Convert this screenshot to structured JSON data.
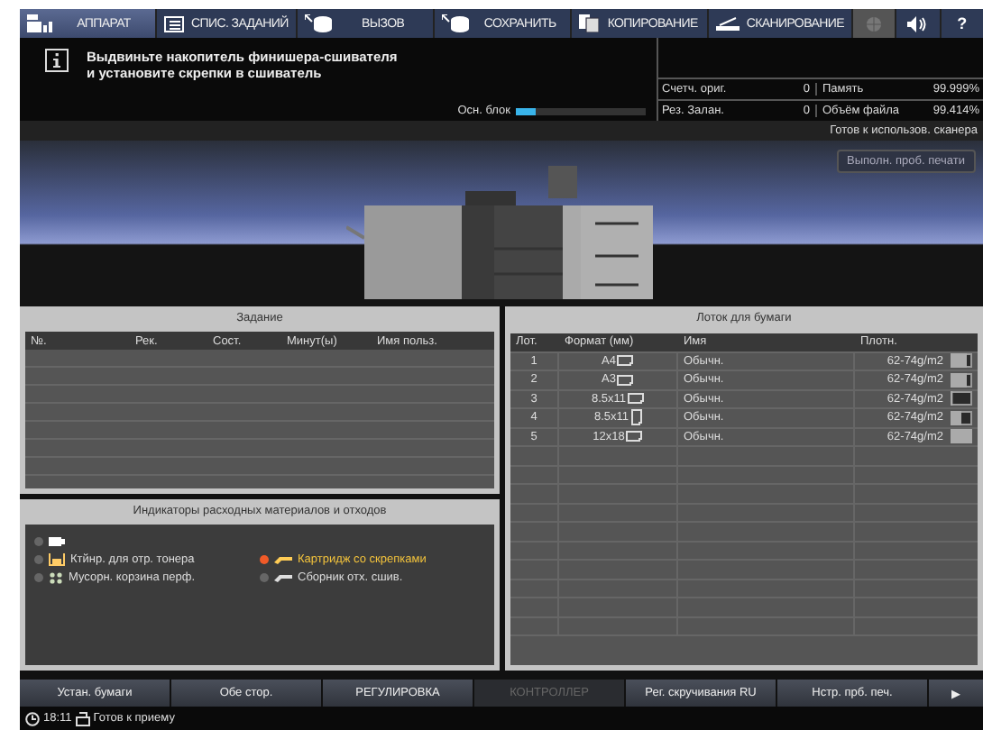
{
  "nav_tabs": [
    {
      "label": "АППАРАТ",
      "kind": "machine",
      "selected": true
    },
    {
      "label": "СПИС. ЗАДАНИЙ",
      "kind": "list",
      "selected": false
    },
    {
      "label": "ВЫЗОВ",
      "kind": "recall",
      "selected": false
    },
    {
      "label": "СОХРАНИТЬ",
      "kind": "save",
      "selected": false
    },
    {
      "label": "КОПИРОВАНИЕ",
      "kind": "copy",
      "selected": false
    },
    {
      "label": "СКАНИРОВАНИЕ",
      "kind": "scan",
      "selected": false
    }
  ],
  "nav_icons": [
    {
      "kind": "globe",
      "disabled": true
    },
    {
      "kind": "speaker",
      "disabled": false
    },
    {
      "kind": "help",
      "label": "?",
      "disabled": false
    }
  ],
  "message": {
    "lines": [
      "Выдвиньте накопитель финишера-сшивателя",
      "и установите скрепки в сшиватель"
    ],
    "progress_label": "Осн. блок",
    "level": 0.15
  },
  "counters": [
    {
      "label": "Счетч. ориг.",
      "value": "0",
      "label2": "Память",
      "value2": "99.999%"
    },
    {
      "label": "Рез. Залан.",
      "value": "0",
      "label2": "Объём файла",
      "value2": "99.414%"
    }
  ],
  "status_line": "Готов к использов. сканера",
  "test_print_button": "Выполн. проб. печати",
  "job_panel": {
    "title": "Задание",
    "columns": [
      "№.",
      "Рек.",
      "Сост.",
      "Минут(ы)",
      "Имя польз."
    ]
  },
  "consumables": {
    "title": "Индикаторы расходных материалов и отходов",
    "items": [
      {
        "kind": "cartridge",
        "alert": false
      },
      {
        "label": "Ктйнр. для отр. тонера",
        "kind": "toner",
        "alert": false
      },
      {
        "label": "Картридж со скрепками",
        "kind": "staple",
        "alert": true
      },
      {
        "label": "Мусорн. корзина перф.",
        "kind": "punch",
        "alert": false
      },
      {
        "label": "Сборник отх. сшив.",
        "kind": "staple",
        "alert": false
      }
    ]
  },
  "tray_panel": {
    "title": "Лоток для бумаги",
    "columns": [
      "Лот.",
      "Формат (мм)",
      "Имя",
      "Плотн."
    ],
    "rows": [
      {
        "tray": "1",
        "format": "A4",
        "kind": "landscape",
        "name": "Обычн.",
        "weight": "62-74g/m2",
        "level": 0.75
      },
      {
        "tray": "2",
        "format": "A3",
        "kind": "landscape",
        "name": "Обычн.",
        "weight": "62-74g/m2",
        "level": 0.75
      },
      {
        "tray": "3",
        "format": "8.5x11",
        "kind": "landscape",
        "name": "Обычн.",
        "weight": "62-74g/m2",
        "level": 0.1
      },
      {
        "tray": "4",
        "format": "8.5x11",
        "kind": "portrait",
        "name": "Обычн.",
        "weight": "62-74g/m2",
        "level": 0.5
      },
      {
        "tray": "5",
        "format": "12x18",
        "kind": "landscape",
        "name": "Обычн.",
        "weight": "62-74g/m2",
        "level": 1
      }
    ]
  },
  "bottom_buttons": [
    {
      "label": "Устан. бумаги",
      "disabled": false
    },
    {
      "label": "Обе стор.",
      "disabled": false
    },
    {
      "label": "РЕГУЛИРОВКА",
      "disabled": false
    },
    {
      "label": "КОНТРОЛЛЕР",
      "disabled": true
    },
    {
      "label": "Рег. скручивания RU",
      "disabled": false
    },
    {
      "label": "Нстр. прб. печ.",
      "disabled": false
    },
    {
      "label": "▶",
      "disabled": false
    }
  ],
  "status_bar": {
    "time": "18:11",
    "state": "Готов к приему"
  }
}
